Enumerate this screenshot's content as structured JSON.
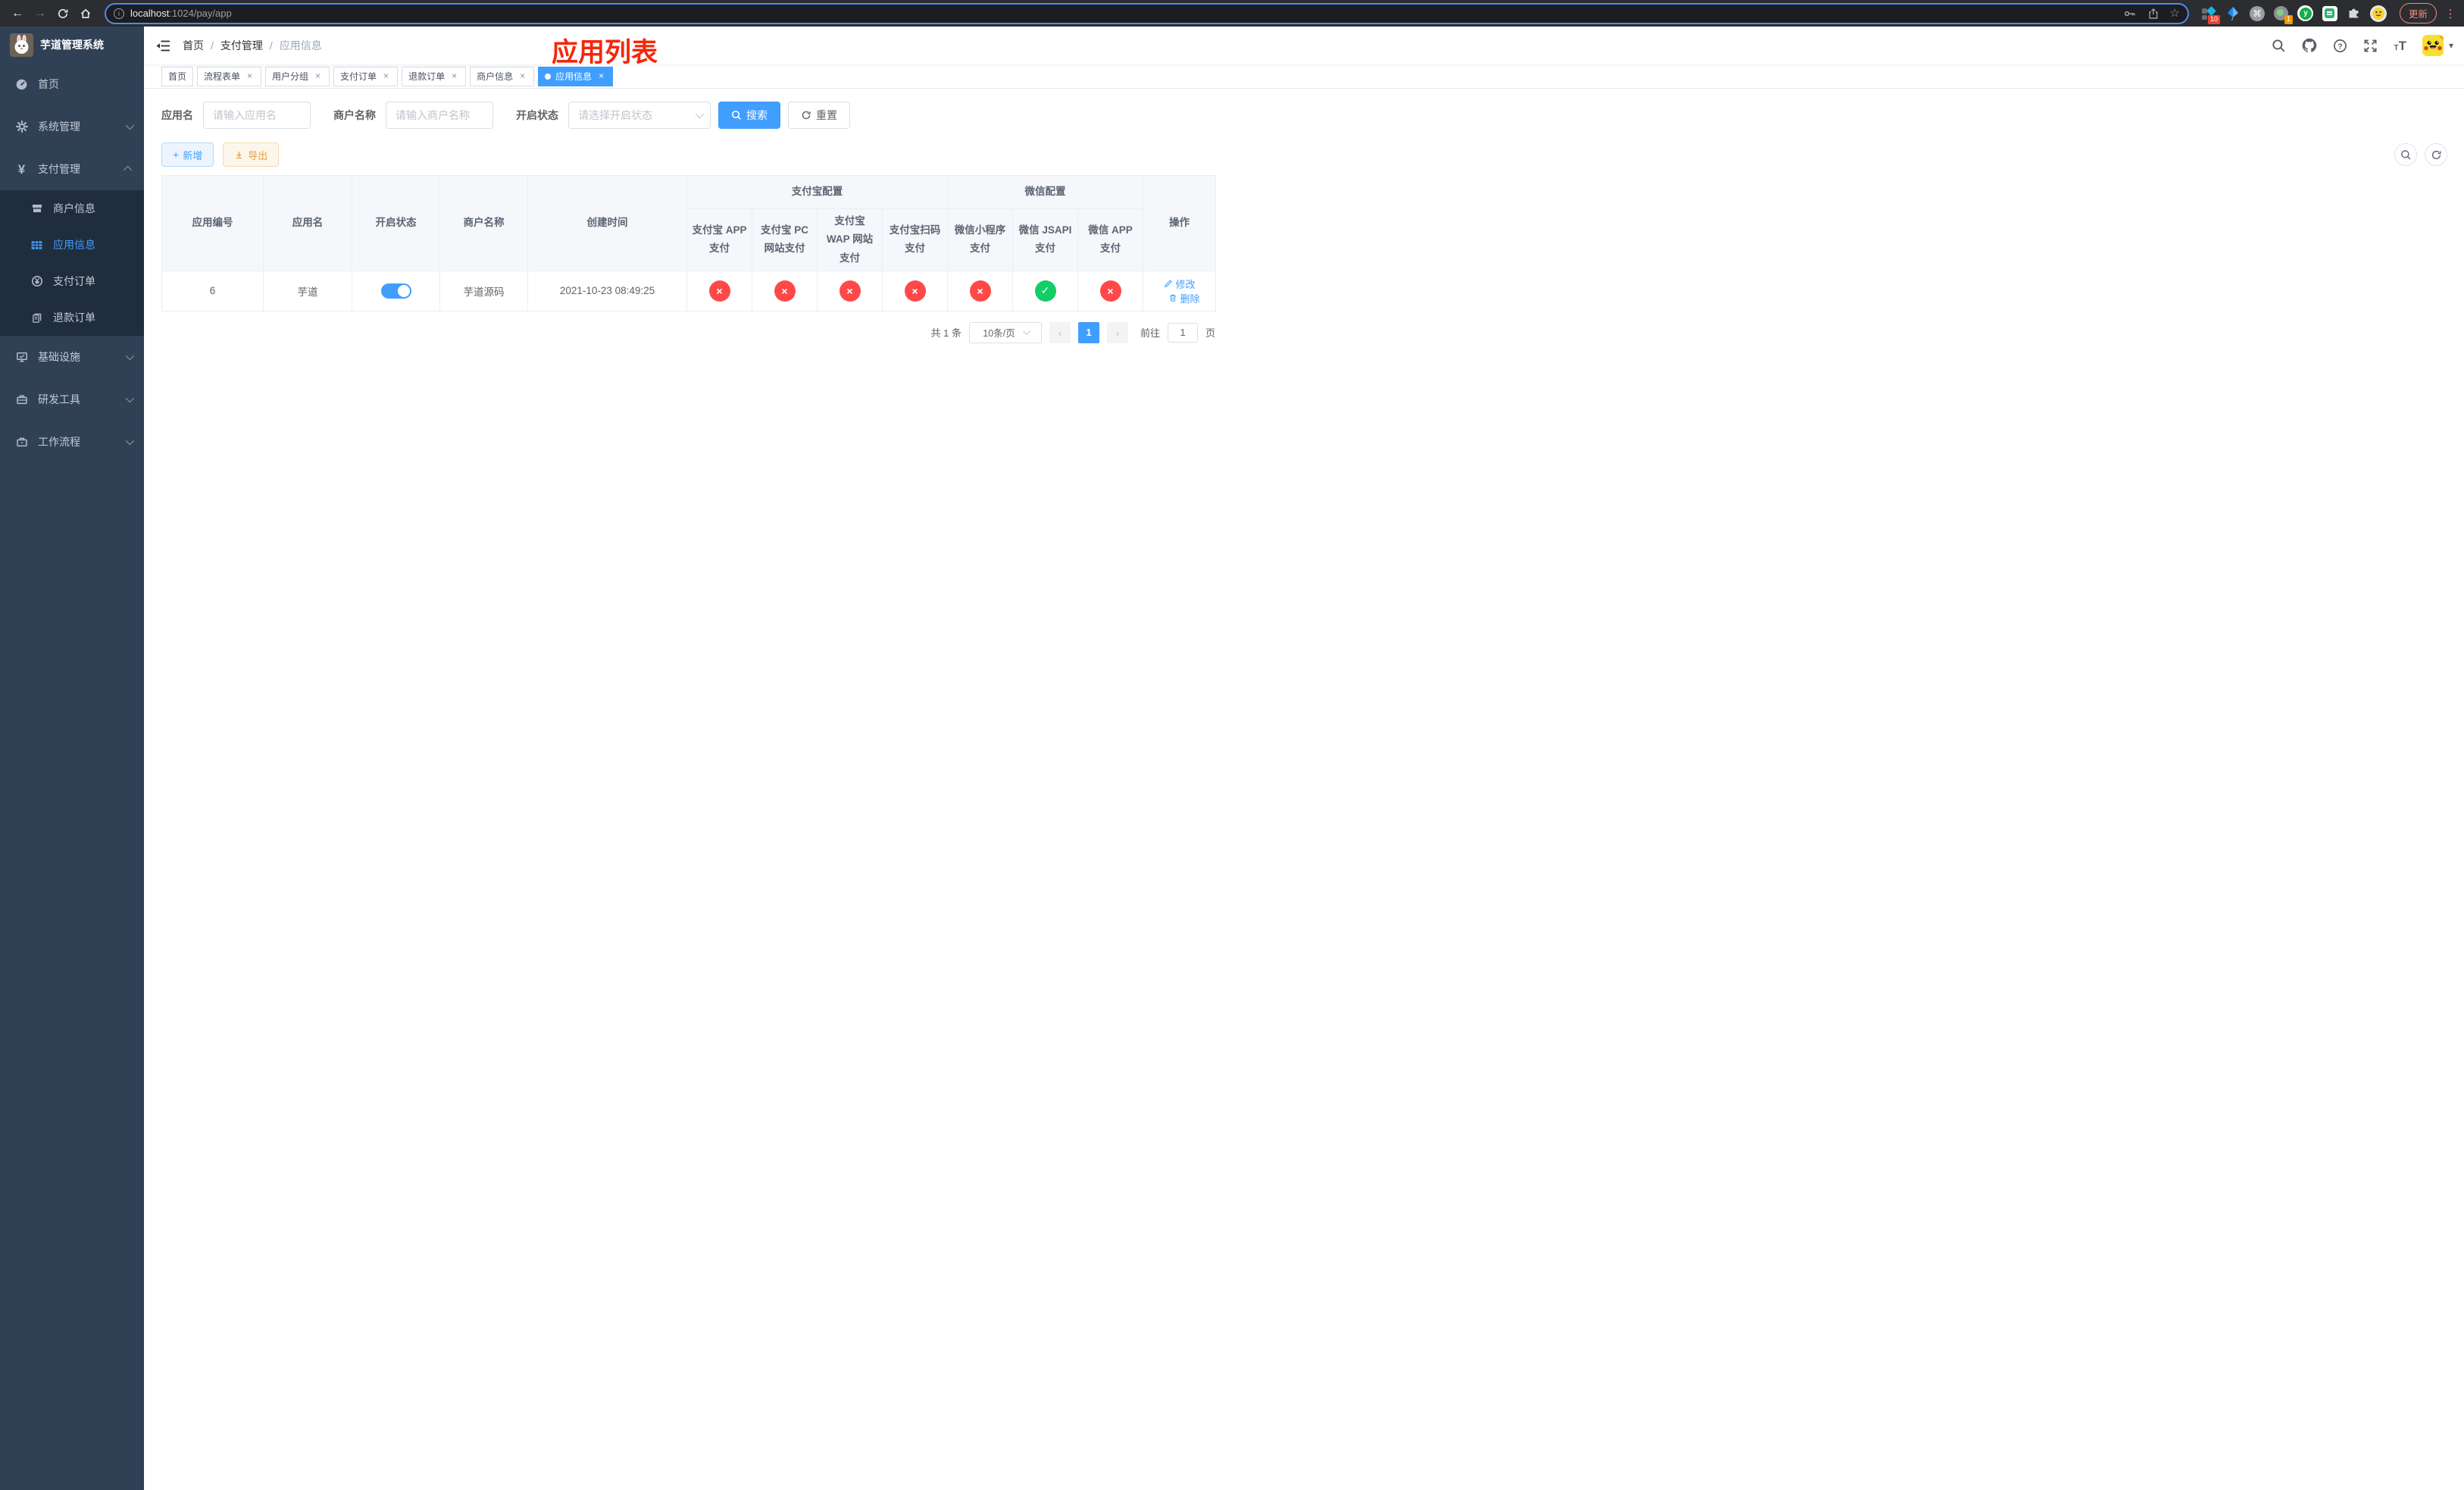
{
  "browser": {
    "url_host": "localhost",
    "url_path": ":1024/pay/app",
    "update_label": "更新",
    "ext_badge_10": "10",
    "ext_badge_1": "1",
    "y_ext_label": "y"
  },
  "sidebar": {
    "title": "芋道管理系统",
    "items": {
      "home": "首页",
      "system": "系统管理",
      "pay": "支付管理",
      "infra": "基础设施",
      "dev": "研发工具",
      "workflow": "工作流程"
    },
    "sub": {
      "merchant": "商户信息",
      "app": "应用信息",
      "order": "支付订单",
      "refund": "退款订单"
    }
  },
  "navbar": {
    "breadcrumb": [
      "首页",
      "支付管理",
      "应用信息"
    ],
    "separator": "/",
    "annotation": "应用列表"
  },
  "tags": [
    {
      "label": "首页"
    },
    {
      "label": "流程表单"
    },
    {
      "label": "用户分组"
    },
    {
      "label": "支付订单"
    },
    {
      "label": "退款订单"
    },
    {
      "label": "商户信息"
    },
    {
      "label": "应用信息"
    }
  ],
  "filters": {
    "app_name_label": "应用名",
    "app_name_placeholder": "请输入应用名",
    "merchant_label": "商户名称",
    "merchant_placeholder": "请输入商户名称",
    "status_label": "开启状态",
    "status_placeholder": "请选择开启状态",
    "search_label": "搜索",
    "reset_label": "重置"
  },
  "toolbar": {
    "add_label": "新增",
    "export_label": "导出"
  },
  "table": {
    "group_headers": {
      "alipay": "支付宝配置",
      "wechat": "微信配置"
    },
    "headers": {
      "id": "应用编号",
      "name": "应用名",
      "status": "开启状态",
      "merchant": "商户名称",
      "created": "创建时间",
      "alipay_app": "支付宝 APP 支付",
      "alipay_pc": "支付宝 PC 网站支付",
      "alipay_wap": "支付宝 WAP 网站支付",
      "alipay_qr": "支付宝扫码支付",
      "wx_lite": "微信小程序支付",
      "wx_jsapi": "微信 JSAPI 支付",
      "wx_app": "微信 APP 支付",
      "actions": "操作"
    },
    "row": {
      "id": "6",
      "name": "芋道",
      "enabled": true,
      "merchant": "芋道源码",
      "created": "2021-10-23 08:49:25",
      "channel_status": [
        false,
        false,
        false,
        false,
        false,
        true,
        false
      ],
      "edit_label": "修改",
      "delete_label": "删除"
    }
  },
  "pagination": {
    "total": "共 1 条",
    "page_size": "10条/页",
    "page": "1",
    "goto_label": "前往",
    "goto_value": "1",
    "page_unit": "页"
  },
  "colors": {
    "primary": "#409eff",
    "success": "#13ce66",
    "danger": "#ff4949",
    "annotation_red": "#f5270c"
  },
  "icons": {
    "back": "←",
    "forward": "→",
    "star": "☆",
    "command": "⌘",
    "more": "⋮",
    "caret": "▾",
    "prev": "‹",
    "next": "›",
    "close": "×",
    "check": "✓",
    "cross": "×",
    "plus": "+",
    "question": "?",
    "info": "i"
  }
}
